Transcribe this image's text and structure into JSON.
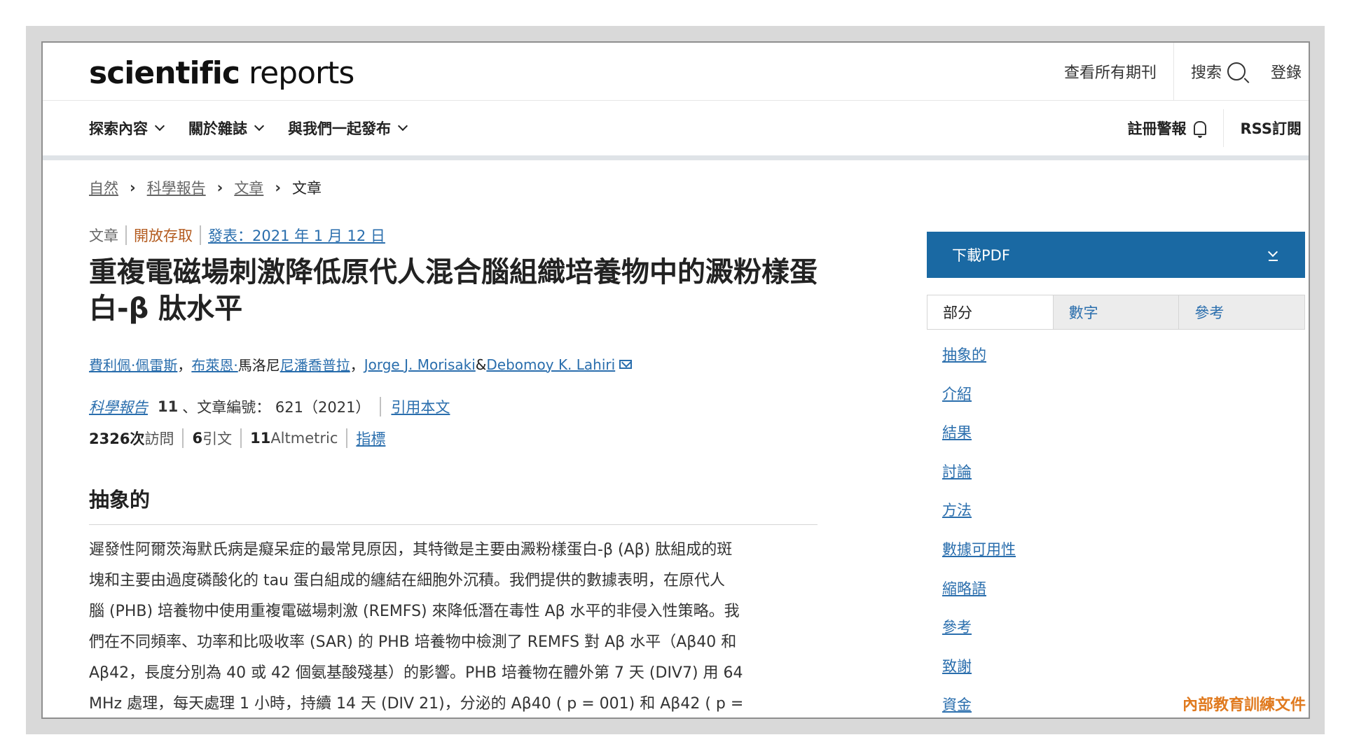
{
  "header": {
    "logo_bold": "scientific",
    "logo_light": " reports",
    "links": [
      "查看所有期刊",
      "搜索",
      "登錄"
    ]
  },
  "nav": {
    "left": [
      "探索內容",
      "關於雜誌",
      "與我們一起發布"
    ],
    "alerts": "註冊警報",
    "rss": "RSS訂閱"
  },
  "breadcrumb": [
    "自然",
    "科學報告",
    "文章",
    "文章"
  ],
  "article": {
    "type": "文章",
    "access": "開放存取",
    "published": "發表：2021 年 1 月 12 日",
    "title": "重複電磁場刺激降低原代人混合腦組織培養物中的澱粉樣蛋白-β 肽水平",
    "authors": {
      "a1": "費利佩·佩雷斯",
      "sep1": "，",
      "a2": "布萊恩·",
      "a2b": "馬洛尼",
      "a3": "尼潘喬普拉",
      "sep2": "，",
      "a4": "Jorge J. Morisaki",
      "amp": " &",
      "a5": "Debomoy K. Lahiri"
    },
    "journal": "科學報告",
    "volume": "11",
    "article_no": "、文章編號： 621（2021）",
    "cite": "引用本文",
    "metrics": {
      "accesses_num": "2326次",
      "accesses_label": " 訪問",
      "citations_num": "6",
      "citations_label": " 引文",
      "altmetric_num": "11",
      "altmetric_label": " Altmetric",
      "metrics_link": "指標"
    },
    "abstract_heading": "抽象的",
    "abstract_lines": [
      "遲發性阿爾茨海默氏病是癡呆症的最常見原因，其特徵是主要由澱粉樣蛋白-β (Aβ) 肽組成的斑",
      "塊和主要由過度磷酸化的 tau 蛋白組成的纏結在細胞外沉積。我們提供的數據表明，在原代人",
      "腦 (PHB) 培養物中使用重複電磁場刺激 (REMFS) 來降低潛在毒性 Aβ 水平的非侵入性策略。我",
      "們在不同頻率、功率和比吸收率 (SAR) 的 PHB 培養物中檢測了 REMFS 對 Aβ 水平（Aβ40 和",
      "Aβ42，長度分別為 40 或 42 個氨基酸殘基）的影響。PHB 培養物在體外第 7 天 (DIV7) 用 64",
      "MHz 處理，每天處理 1 小時，持續 14 天 (DIV 21)，分泌的 Aβ40 ( p  = 001) 和 Aβ42 ( p ="
    ]
  },
  "sidebar": {
    "download": "下載PDF",
    "tabs": [
      "部分",
      "數字",
      "參考"
    ],
    "toc": [
      "抽象的",
      "介紹",
      "結果",
      "討論",
      "方法",
      "數據可用性",
      "縮略語",
      "參考",
      "致謝",
      "資金"
    ]
  },
  "watermark": "內部教育訓練文件"
}
